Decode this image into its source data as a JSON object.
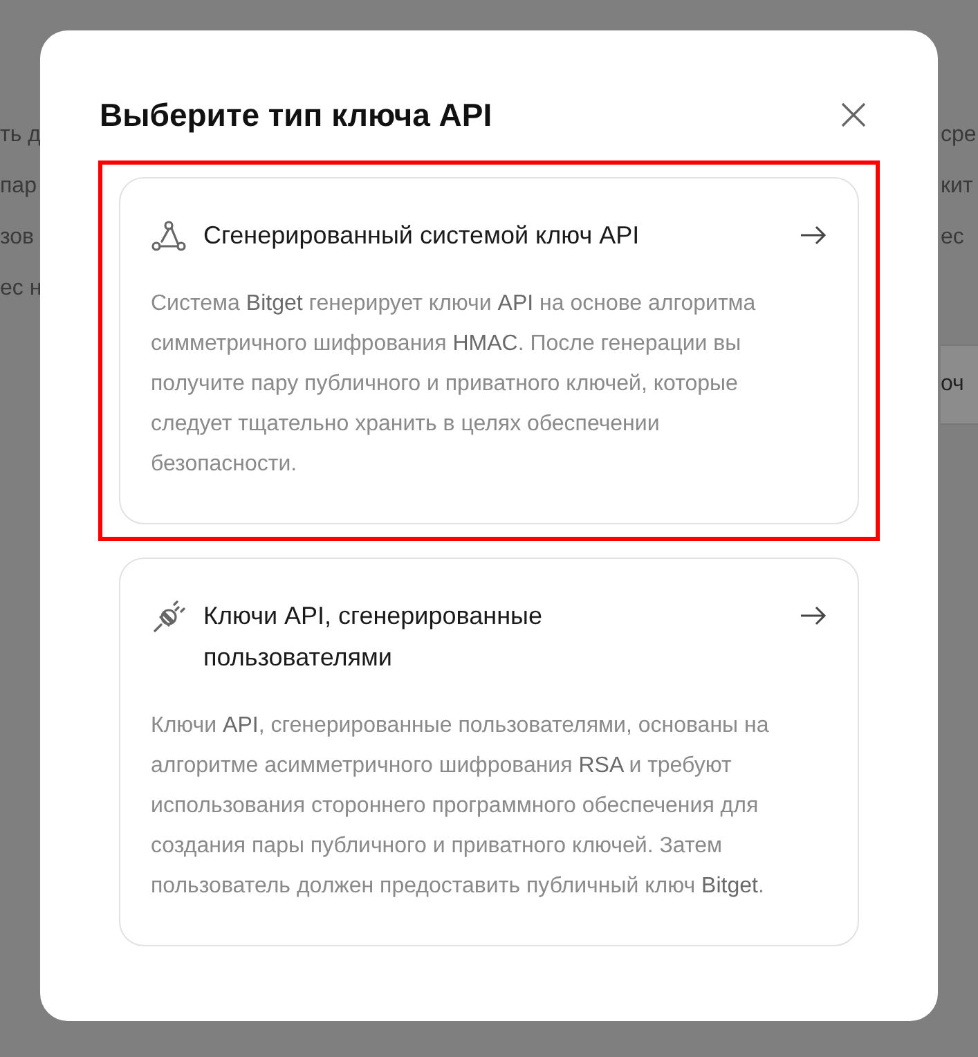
{
  "backdrop": {
    "left_lines": [
      "ть д",
      "пар",
      "зов",
      "ес н"
    ],
    "right_lines": [
      "сре",
      "кит",
      "ес"
    ],
    "right_button": "оч"
  },
  "dialog": {
    "title": "Выберите тип ключа API",
    "options": [
      {
        "kind": "system",
        "title": "Сгенерированный системой ключ API",
        "description": "Система **Bitget** генерирует ключи **API** на основе алгоритма симметричного шифрования **HMAC**. После генерации вы получите пару публичного и приватного ключей, которые следует тщательно хранить в целях обеспечении безопасности.",
        "selected": true
      },
      {
        "kind": "user",
        "title": "Ключи API, сгенерированные пользователями",
        "description": "Ключи **API**, сгенерированные пользователями, основаны на алгоритме асимметричного шифрования **RSA** и требуют использования стороннего программного обеспечения для создания пары публичного и приватного ключей. Затем пользователь должен предоставить публичный ключ **Bitget**.",
        "selected": false
      }
    ]
  }
}
